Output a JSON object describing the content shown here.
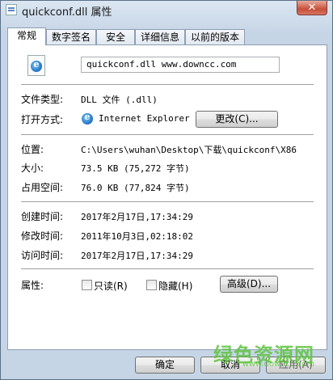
{
  "window": {
    "title": "quickconf.dll 属性",
    "close_label": "✕"
  },
  "tabs": [
    {
      "label": "常规"
    },
    {
      "label": "数字签名"
    },
    {
      "label": "安全"
    },
    {
      "label": "详细信息"
    },
    {
      "label": "以前的版本"
    }
  ],
  "general": {
    "file_name": "quickconf.dll  www.downcc.com",
    "file_type_label": "文件类型:",
    "file_type_value": "DLL 文件 (.dll)",
    "opens_with_label": "打开方式:",
    "opens_with_value": "Internet Explorer",
    "change_button": "更改(C)...",
    "location_label": "位置:",
    "location_value": "C:\\Users\\wuhan\\Desktop\\下载\\quickconf\\X86",
    "size_label": "大小:",
    "size_value": "73.5 KB (75,272 字节)",
    "disk_size_label": "占用空间:",
    "disk_size_value": "76.0 KB (77,824 字节)",
    "created_label": "创建时间:",
    "created_value": "2017年2月17日,17:34:29",
    "modified_label": "修改时间:",
    "modified_value": "2011年10月3日,02:18:02",
    "accessed_label": "访问时间:",
    "accessed_value": "2017年2月17日,17:34:29",
    "attributes_label": "属性:",
    "readonly_label": "只读(R)",
    "hidden_label": "隐藏(H)",
    "advanced_button": "高级(D)..."
  },
  "footer": {
    "ok": "确定",
    "cancel": "取消",
    "apply": "应用(A)"
  },
  "watermark": {
    "text": "绿色资源网",
    "sub": "www.downcc.com"
  },
  "icons": {
    "title": "file-icon",
    "file": "ie-file-icon",
    "app": "ie-icon"
  }
}
